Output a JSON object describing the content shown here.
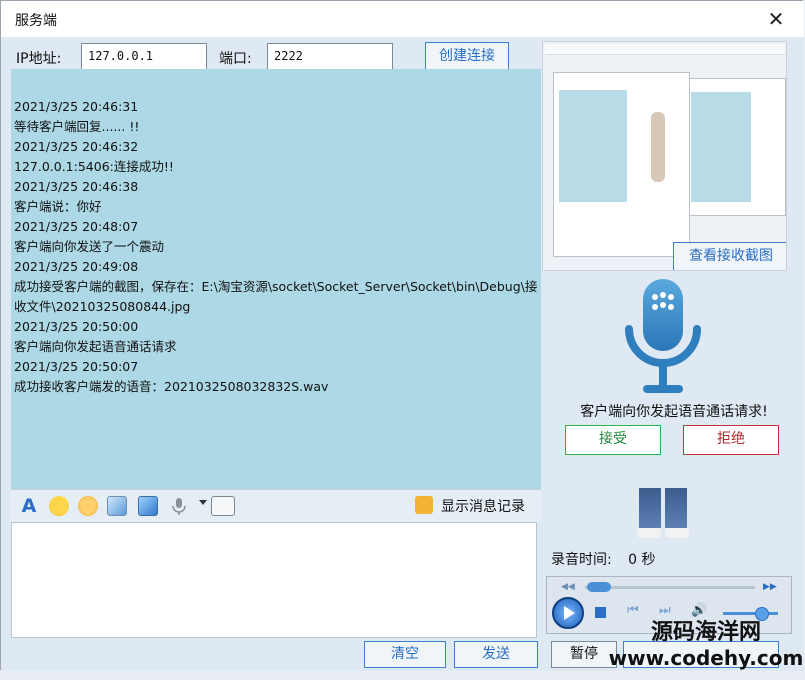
{
  "window": {
    "title": "服务端",
    "close_glyph": "✕"
  },
  "connection": {
    "ip_label": "IP地址:",
    "ip_value": "127.0.0.1",
    "port_label": "端口:",
    "port_value": "2222",
    "connect_button": "创建连接"
  },
  "log": {
    "lines": [
      "2021/3/25 20:46:31",
      "等待客户端回复...... !!",
      "2021/3/25 20:46:32",
      "127.0.0.1:5406:连接成功!!",
      "2021/3/25 20:46:38",
      "客户端说：你好",
      "2021/3/25 20:48:07",
      "客户端向你发送了一个震动",
      "2021/3/25 20:49:08",
      "成功接受客户端的截图，保存在：E:\\淘宝资源\\socket\\Socket_Server\\Socket\\bin\\Debug\\接收文件\\20210325080844.jpg",
      "2021/3/25 20:50:00",
      "客户端向你发起语音通话请求",
      "2021/3/25 20:50:07",
      "成功接收客户端发的语音：2021032508032832S.wav"
    ]
  },
  "toolbar": {
    "icons": [
      "font-icon",
      "emoji-icon",
      "shake-icon",
      "image-icon",
      "screenshot-icon",
      "microphone-icon",
      "dropdown-arrow-icon",
      "send-file-icon"
    ],
    "history_button": "显示消息记录"
  },
  "screenshot_panel": {
    "view_button": "查看接收截图"
  },
  "voice": {
    "prompt": "客户端向你发起语音通话请求!",
    "accept": "接受",
    "reject": "拒绝",
    "record_time_label": "录音时间:",
    "record_time_value": "0 秒"
  },
  "bottom": {
    "clear_button": "清空",
    "send_button": "发送",
    "pause_button": "暂停"
  },
  "watermark": {
    "line1": "源码海洋网",
    "line2": "www.codehy.com"
  },
  "colors": {
    "log_bg": "#add8e6",
    "accent": "#2a6ec5",
    "accept": "#22883a",
    "reject": "#b3262b"
  }
}
